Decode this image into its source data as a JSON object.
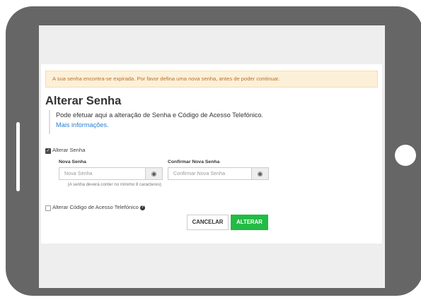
{
  "alert": {
    "text": "A sua senha encontra-se expirada. Por favor defina uma nova senha, antes de poder continuar."
  },
  "title": "Alterar Senha",
  "description": {
    "text": "Pode efetuar aqui a alteração de Senha e Código de Acesso Telefónico.",
    "link": "Mais informações."
  },
  "options": {
    "change_password": {
      "label": "Alterar Senha",
      "checked": true
    },
    "change_phone_code": {
      "label": "Alterar Código de Acesso Telefónico",
      "checked": false
    }
  },
  "fields": {
    "new_password": {
      "label": "Nova Senha",
      "placeholder": "Nova Senha",
      "hint": "(A senha deverá conter no mínimo 8 caracteres)"
    },
    "confirm_password": {
      "label": "Confirmar Nova Senha",
      "placeholder": "Confirmar Nova Senha"
    }
  },
  "buttons": {
    "cancel": "CANCELAR",
    "submit": "ALTERAR"
  },
  "colors": {
    "frame": "#666666",
    "alert_bg": "#fcf0d8",
    "alert_text": "#b8722a",
    "link": "#2a7fd4",
    "primary": "#22bb44"
  },
  "icons": {
    "eye": "eye-icon",
    "help": "question-circle-icon",
    "check": "checkmark-icon"
  }
}
